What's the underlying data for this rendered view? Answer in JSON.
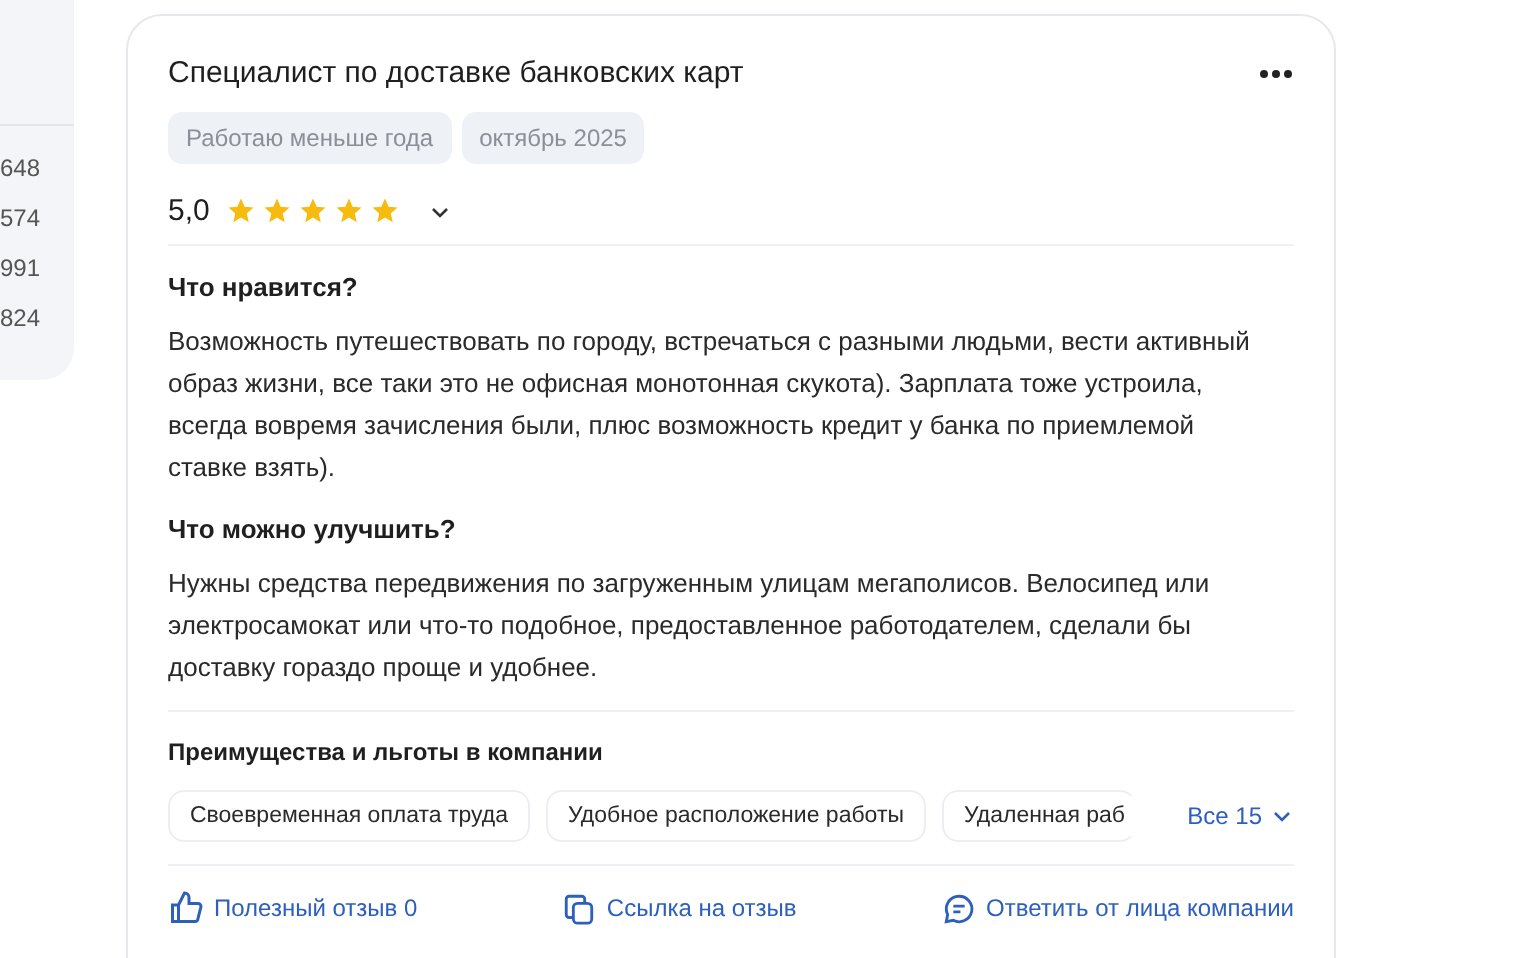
{
  "sidebar": {
    "counts": [
      "648",
      "574",
      "991",
      "824"
    ]
  },
  "review": {
    "title": "Специалист по доставке банковских карт",
    "tags": [
      "Работаю меньше года",
      "октябрь 2025"
    ],
    "rating": "5,0",
    "stars": 5,
    "sections": [
      {
        "heading": "Что нравится?",
        "text": "Возможность путешествовать по городу, встречаться с разными людьми, вести активный образ жизни, все таки это не офисная монотонная скукота). Зарплата тоже устроила, всегда вовремя зачисления были, плюс возможность кредит у банка по приемлемой ставке взять)."
      },
      {
        "heading": "Что можно улучшить?",
        "text": "Нужны средства передвижения по загруженным улицам мегаполисов. Велосипед или электросамокат или что-то подобное, предоставленное работодателем, сделали бы доставку гораздо проще и удобнее."
      }
    ],
    "benefits": {
      "heading": "Преимущества и льготы в компании",
      "items": [
        "Своевременная оплата труда",
        "Удобное расположение работы",
        "Удаленная раб"
      ],
      "more": "Все 15"
    },
    "actions": [
      {
        "kind": "like",
        "label": "Полезный отзыв 0"
      },
      {
        "kind": "link",
        "label": "Ссылка на отзыв"
      },
      {
        "kind": "reply",
        "label": "Ответить от лица компании"
      }
    ]
  }
}
